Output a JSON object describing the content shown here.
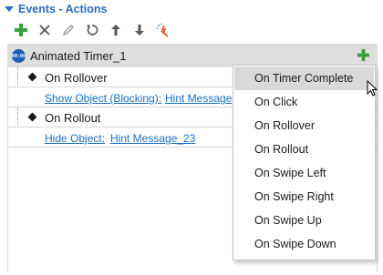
{
  "panel": {
    "title": "Events - Actions"
  },
  "toolbar": {
    "buttons": [
      {
        "icon": "plus-icon",
        "color": "#3aa23a"
      },
      {
        "icon": "close-icon",
        "color": "#555555"
      },
      {
        "icon": "pencil-icon",
        "color": "#9a9a9a"
      },
      {
        "icon": "undo-icon",
        "color": "#555555"
      },
      {
        "icon": "arrow-up-icon",
        "color": "#555555"
      },
      {
        "icon": "arrow-down-icon",
        "color": "#555555"
      },
      {
        "icon": "magic-wand-icon",
        "color": "#e0522a"
      }
    ]
  },
  "event": {
    "icon_text": "00:00",
    "label": "Animated Timer_1"
  },
  "triggers": [
    {
      "label": "On Rollover",
      "action": "Show Object (Blocking):",
      "target": "Hint Message"
    },
    {
      "label": "On Rollout",
      "action": "Hide Object:",
      "target": "Hint Message_23"
    }
  ],
  "dropdown": {
    "items": [
      "On Timer Complete",
      "On Click",
      "On Rollover",
      "On Rollout",
      "On Swipe Left",
      "On Swipe Right",
      "On Swipe Up",
      "On Swipe Down"
    ],
    "hovered_index": 0
  },
  "colors": {
    "accent": "#2a6ebf",
    "link": "#1a6fc0",
    "event_row_bg": "#dedede",
    "plus_green": "#3aa23a"
  }
}
